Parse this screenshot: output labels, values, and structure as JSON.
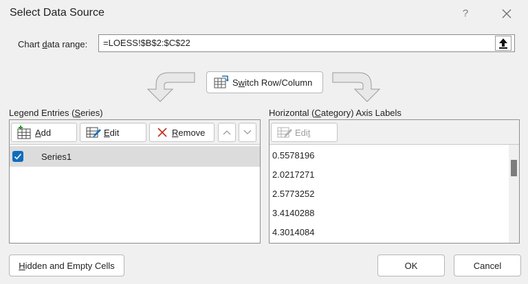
{
  "window": {
    "title": "Select Data Source",
    "help_label": "?"
  },
  "range": {
    "label_pre": "Chart ",
    "label_accel": "d",
    "label_post": "ata range:",
    "value": "=LOESS!$B$2:$C$22"
  },
  "switch": {
    "label_pre": "S",
    "label_accel": "w",
    "label_post": "itch Row/Column"
  },
  "legend": {
    "title_pre": "Legend Entries (",
    "title_accel": "S",
    "title_post": "eries)",
    "add_label": "Add",
    "add_accel": "A",
    "add_rest": "dd",
    "edit_accel": "E",
    "edit_rest": "dit",
    "remove_accel": "R",
    "remove_rest": "emove",
    "series": [
      {
        "label": "Series1",
        "checked": true
      }
    ]
  },
  "axis": {
    "title_pre": "Horizontal (",
    "title_accel": "C",
    "title_post": "ategory) Axis Labels",
    "edit_pre": "Edi",
    "edit_accel": "t",
    "labels": [
      "0.5578196",
      "2.0217271",
      "2.5773252",
      "3.4140288",
      "4.3014084"
    ]
  },
  "footer": {
    "hidden_accel": "H",
    "hidden_rest": "idden and Empty Cells",
    "ok_label": "OK",
    "cancel_label": "Cancel"
  },
  "colors": {
    "accent": "#0f6cbd",
    "remove_red": "#c42b1c",
    "selection_bg": "#dcdcdc"
  }
}
